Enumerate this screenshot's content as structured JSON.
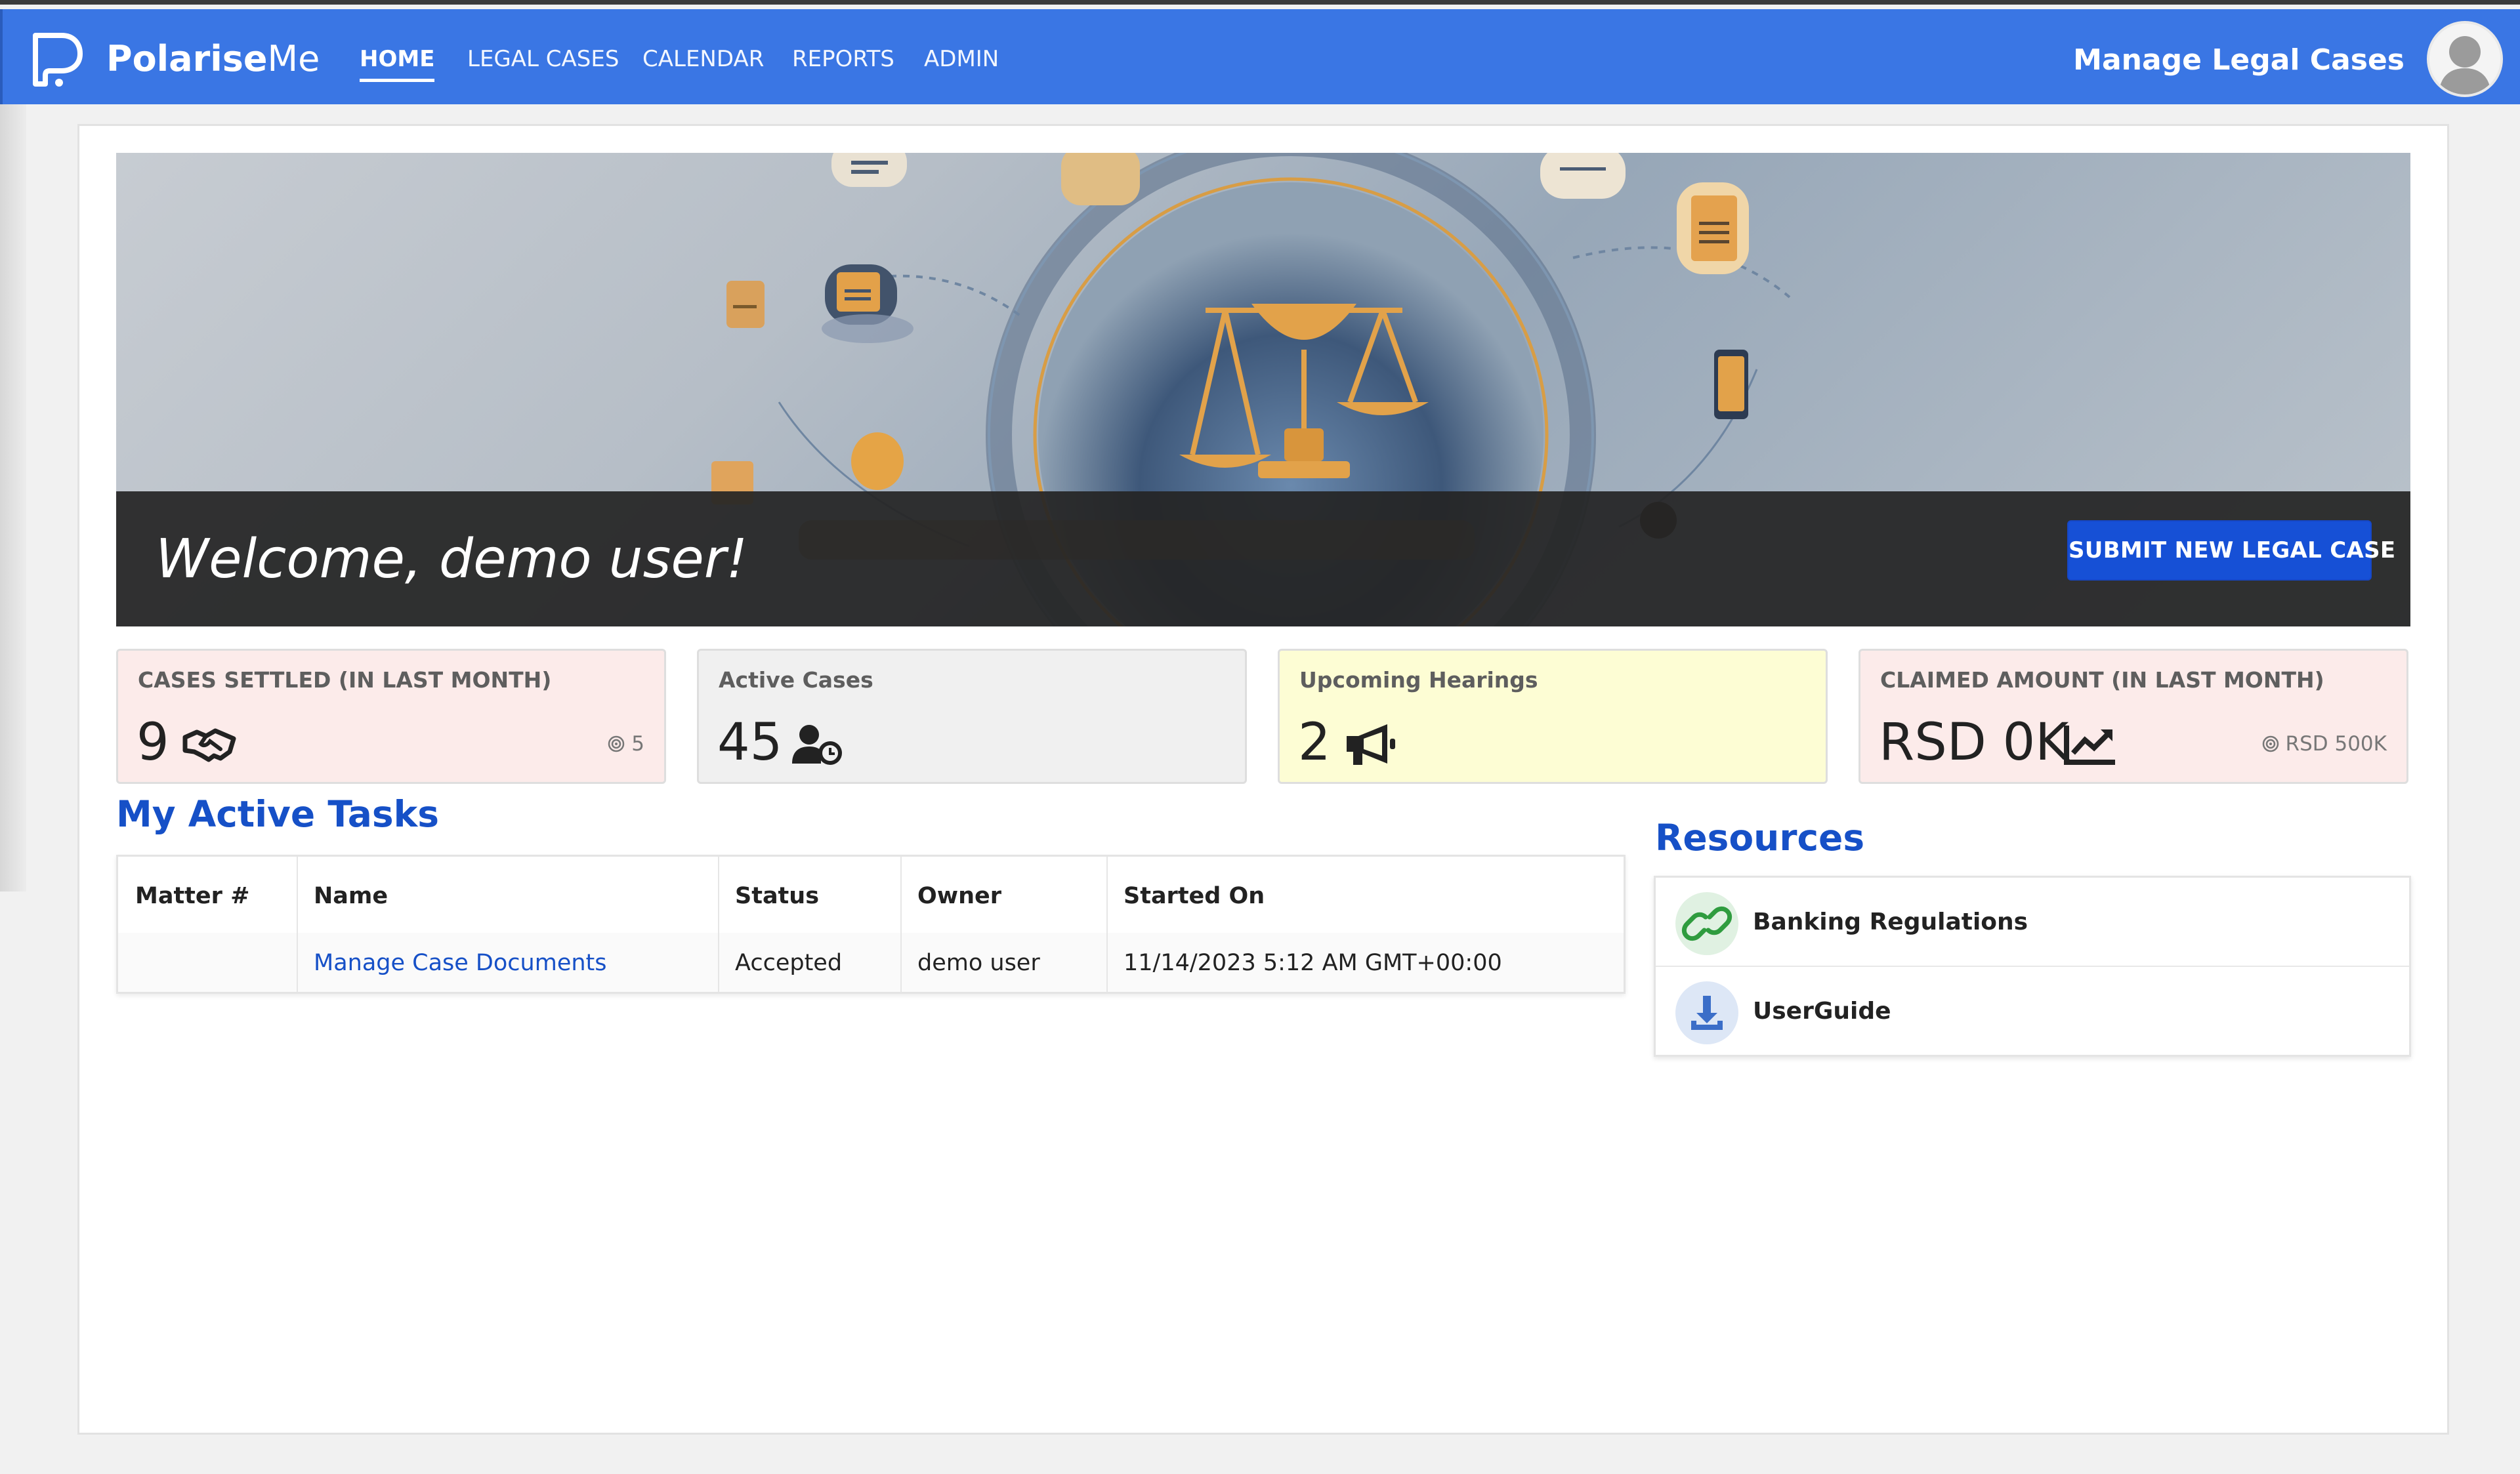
{
  "app": {
    "brand_bold": "Polarise",
    "brand_light": "Me",
    "page_title": "Manage Legal Cases"
  },
  "nav": {
    "items": [
      {
        "label": "HOME",
        "active": true
      },
      {
        "label": "LEGAL CASES",
        "active": false
      },
      {
        "label": "CALENDAR",
        "active": false
      },
      {
        "label": "REPORTS",
        "active": false
      },
      {
        "label": "ADMIN",
        "active": false
      }
    ]
  },
  "hero": {
    "welcome": "Welcome, demo user!",
    "submit_button": "SUBMIT NEW LEGAL CASE"
  },
  "stats": [
    {
      "label": "CASES SETTLED (IN LAST MONTH)",
      "value": "9",
      "icon": "handshake-icon",
      "target": "5",
      "background": "#fcebea"
    },
    {
      "label": "Active Cases",
      "value": "45",
      "icon": "user-clock-icon",
      "target": null,
      "background": "#f0f0f0"
    },
    {
      "label": "Upcoming Hearings",
      "value": "2",
      "icon": "megaphone-icon",
      "target": null,
      "background": "#fdfdd4"
    },
    {
      "label": "CLAIMED AMOUNT (IN LAST MONTH)",
      "value": "RSD 0K",
      "icon": "chart-line-icon",
      "target": "RSD 500K",
      "background": "#fcebea"
    }
  ],
  "tasks": {
    "title": "My Active Tasks",
    "columns": [
      "Matter #",
      "Name",
      "Status",
      "Owner",
      "Started On"
    ],
    "rows": [
      {
        "matter": "",
        "name": "Manage Case Documents",
        "status": "Accepted",
        "owner": "demo user",
        "started_on": "11/14/2023 5:12 AM GMT+00:00"
      }
    ]
  },
  "resources": {
    "title": "Resources",
    "items": [
      {
        "label": "Banking Regulations",
        "icon": "link-icon",
        "color": "#2f9c3f"
      },
      {
        "label": "UserGuide",
        "icon": "download-icon",
        "color": "#3b6ec8"
      }
    ]
  },
  "colors": {
    "navbar": "#3a76e4",
    "accent": "#1650c7",
    "button": "#1650d6"
  }
}
